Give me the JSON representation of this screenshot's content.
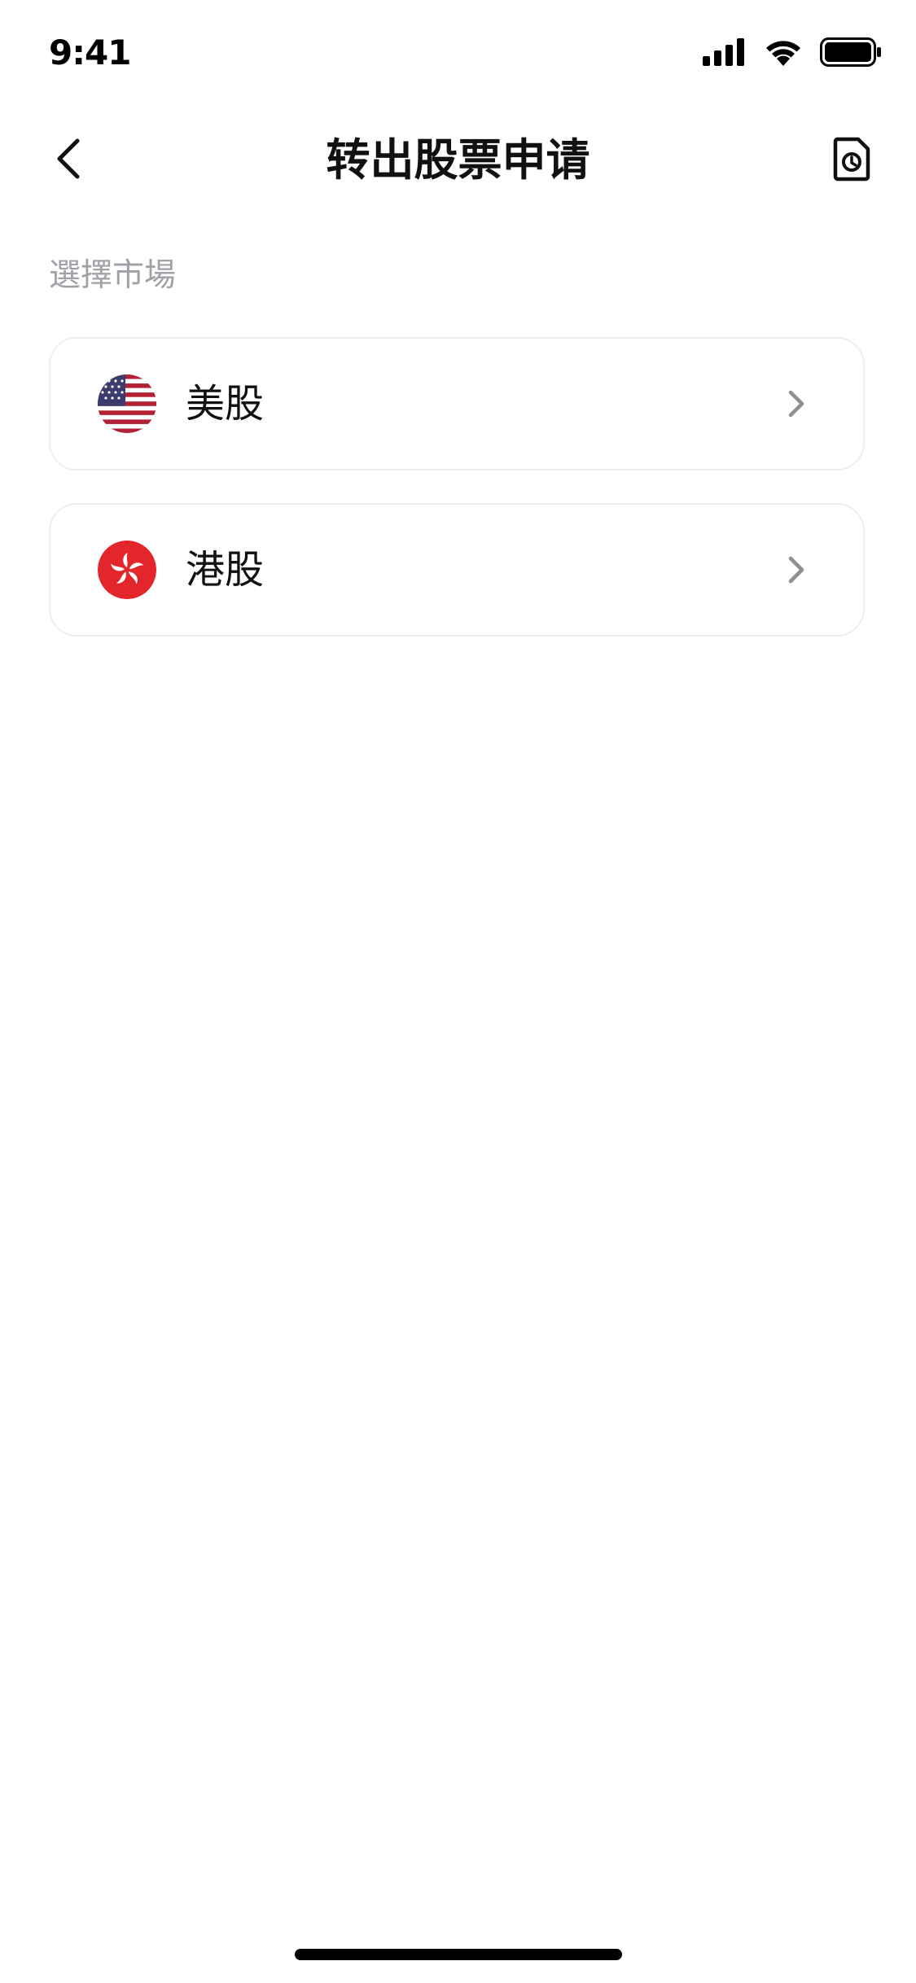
{
  "status_bar": {
    "time": "9:41",
    "icons": [
      "signal-icon",
      "wifi-icon",
      "battery-icon"
    ]
  },
  "header": {
    "title": "转出股票申请",
    "back_icon": "chevron-left-icon",
    "history_icon": "document-clock-icon"
  },
  "section": {
    "label": "選擇市場"
  },
  "markets": [
    {
      "name": "美股",
      "flag": "us-flag-icon"
    },
    {
      "name": "港股",
      "flag": "hk-flag-icon"
    }
  ],
  "colors": {
    "label_gray": "#a0a0a6",
    "card_border": "#eeeeee",
    "chevron_gray": "#8e8e93",
    "hk_red": "#e3262c",
    "us_red": "#b22234",
    "us_blue": "#3c3b6e"
  }
}
